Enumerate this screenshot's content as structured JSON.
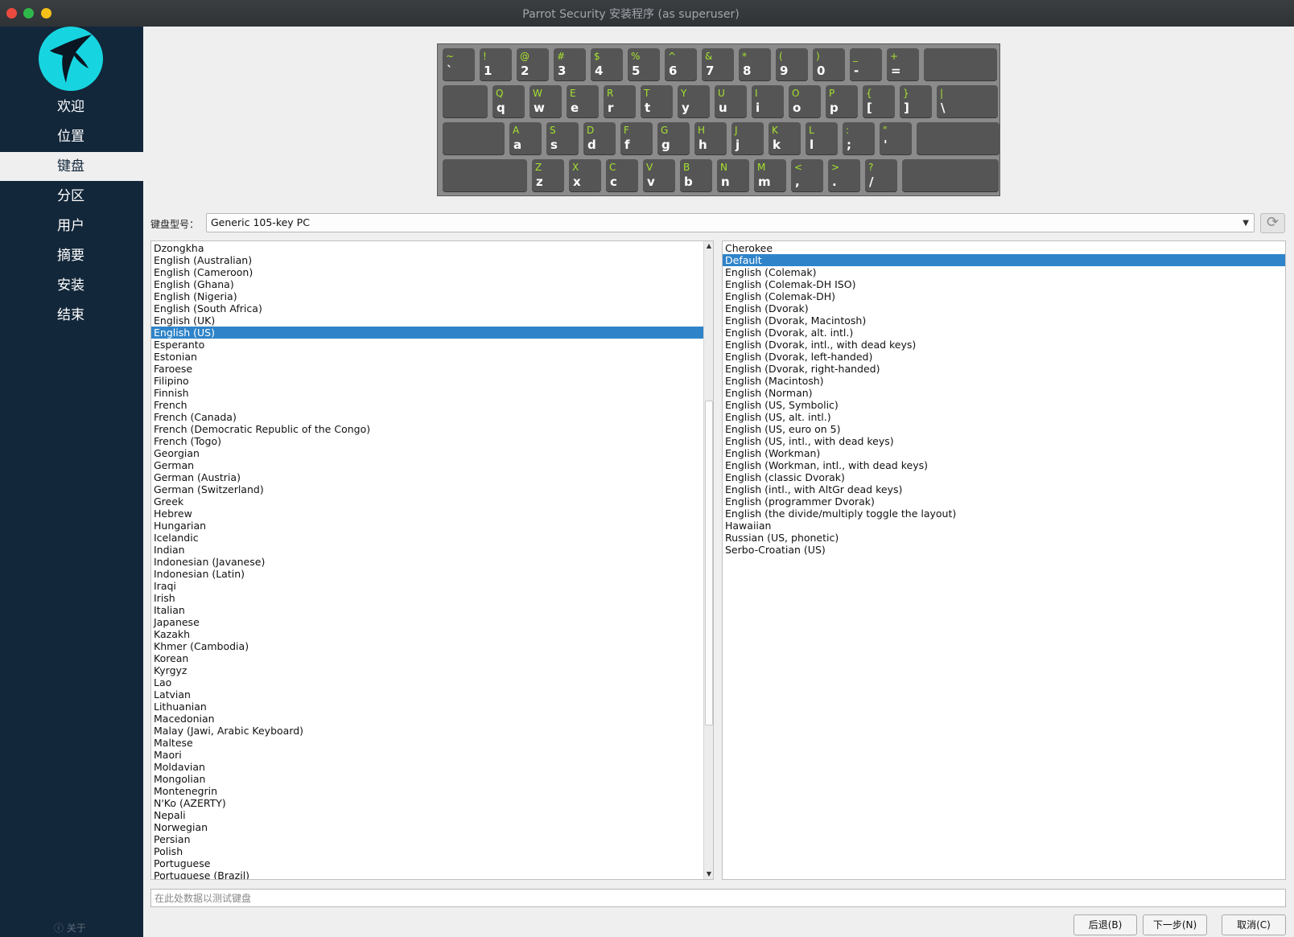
{
  "window": {
    "title": "Parrot Security 安装程序 (as superuser)"
  },
  "sidebar": {
    "logo_icon": "parrot-bird-logo",
    "items": [
      {
        "label": "欢迎"
      },
      {
        "label": "位置"
      },
      {
        "label": "键盘"
      },
      {
        "label": "分区"
      },
      {
        "label": "用户"
      },
      {
        "label": "摘要"
      },
      {
        "label": "安装"
      },
      {
        "label": "结束"
      }
    ],
    "active_index": 2,
    "about_label": "ⓘ 关于"
  },
  "keyboard_preview": {
    "rows": [
      [
        {
          "shift": "~",
          "main": "`"
        },
        {
          "shift": "!",
          "main": "1"
        },
        {
          "shift": "@",
          "main": "2"
        },
        {
          "shift": "#",
          "main": "3"
        },
        {
          "shift": "$",
          "main": "4"
        },
        {
          "shift": "%",
          "main": "5"
        },
        {
          "shift": "^",
          "main": "6"
        },
        {
          "shift": "&",
          "main": "7"
        },
        {
          "shift": "*",
          "main": "8"
        },
        {
          "shift": "(",
          "main": "9"
        },
        {
          "shift": ")",
          "main": "0"
        },
        {
          "shift": "_",
          "main": "-"
        },
        {
          "shift": "+",
          "main": "="
        },
        {
          "shift": "",
          "main": ""
        }
      ],
      [
        {
          "shift": "",
          "main": ""
        },
        {
          "shift": "Q",
          "main": "q"
        },
        {
          "shift": "W",
          "main": "w"
        },
        {
          "shift": "E",
          "main": "e"
        },
        {
          "shift": "R",
          "main": "r"
        },
        {
          "shift": "T",
          "main": "t"
        },
        {
          "shift": "Y",
          "main": "y"
        },
        {
          "shift": "U",
          "main": "u"
        },
        {
          "shift": "I",
          "main": "i"
        },
        {
          "shift": "O",
          "main": "o"
        },
        {
          "shift": "P",
          "main": "p"
        },
        {
          "shift": "{",
          "main": "["
        },
        {
          "shift": "}",
          "main": "]"
        },
        {
          "shift": "|",
          "main": "\\"
        }
      ],
      [
        {
          "shift": "",
          "main": ""
        },
        {
          "shift": "A",
          "main": "a"
        },
        {
          "shift": "S",
          "main": "s"
        },
        {
          "shift": "D",
          "main": "d"
        },
        {
          "shift": "F",
          "main": "f"
        },
        {
          "shift": "G",
          "main": "g"
        },
        {
          "shift": "H",
          "main": "h"
        },
        {
          "shift": "J",
          "main": "j"
        },
        {
          "shift": "K",
          "main": "k"
        },
        {
          "shift": "L",
          "main": "l"
        },
        {
          "shift": ":",
          "main": ";"
        },
        {
          "shift": "\"",
          "main": "'"
        },
        {
          "shift": "",
          "main": ""
        }
      ],
      [
        {
          "shift": "",
          "main": ""
        },
        {
          "shift": "Z",
          "main": "z"
        },
        {
          "shift": "X",
          "main": "x"
        },
        {
          "shift": "C",
          "main": "c"
        },
        {
          "shift": "V",
          "main": "v"
        },
        {
          "shift": "B",
          "main": "b"
        },
        {
          "shift": "N",
          "main": "n"
        },
        {
          "shift": "M",
          "main": "m"
        },
        {
          "shift": "<",
          "main": ","
        },
        {
          "shift": ">",
          "main": "."
        },
        {
          "shift": "?",
          "main": "/"
        },
        {
          "shift": "",
          "main": ""
        }
      ]
    ]
  },
  "model": {
    "label": "键盘型号：",
    "value": "Generic 105-key PC",
    "reset_icon": "reset-icon"
  },
  "layouts": {
    "selected_index": 7,
    "items": [
      "Dzongkha",
      "English (Australian)",
      "English (Cameroon)",
      "English (Ghana)",
      "English (Nigeria)",
      "English (South Africa)",
      "English (UK)",
      "English (US)",
      "Esperanto",
      "Estonian",
      "Faroese",
      "Filipino",
      "Finnish",
      "French",
      "French (Canada)",
      "French (Democratic Republic of the Congo)",
      "French (Togo)",
      "Georgian",
      "German",
      "German (Austria)",
      "German (Switzerland)",
      "Greek",
      "Hebrew",
      "Hungarian",
      "Icelandic",
      "Indian",
      "Indonesian (Javanese)",
      "Indonesian (Latin)",
      "Iraqi",
      "Irish",
      "Italian",
      "Japanese",
      "Kazakh",
      "Khmer (Cambodia)",
      "Korean",
      "Kyrgyz",
      "Lao",
      "Latvian",
      "Lithuanian",
      "Macedonian",
      "Malay (Jawi, Arabic Keyboard)",
      "Maltese",
      "Maori",
      "Moldavian",
      "Mongolian",
      "Montenegrin",
      "N'Ko (AZERTY)",
      "Nepali",
      "Norwegian",
      "Persian",
      "Polish",
      "Portuguese",
      "Portuguese (Brazil)"
    ]
  },
  "variants": {
    "selected_index": 1,
    "items": [
      "Cherokee",
      "Default",
      "English (Colemak)",
      "English (Colemak-DH ISO)",
      "English (Colemak-DH)",
      "English (Dvorak)",
      "English (Dvorak, Macintosh)",
      "English (Dvorak, alt. intl.)",
      "English (Dvorak, intl., with dead keys)",
      "English (Dvorak, left-handed)",
      "English (Dvorak, right-handed)",
      "English (Macintosh)",
      "English (Norman)",
      "English (US, Symbolic)",
      "English (US, alt. intl.)",
      "English (US, euro on 5)",
      "English (US, intl., with dead keys)",
      "English (Workman)",
      "English (Workman, intl., with dead keys)",
      "English (classic Dvorak)",
      "English (intl., with AltGr dead keys)",
      "English (programmer Dvorak)",
      "English (the divide/multiply toggle the layout)",
      "Hawaiian",
      "Russian (US, phonetic)",
      "Serbo-Croatian (US)"
    ]
  },
  "test_input": {
    "placeholder": "在此处数据以测试键盘",
    "value": ""
  },
  "buttons": {
    "back": "后退(B)",
    "next": "下一步(N)",
    "cancel": "取消(C)"
  },
  "colors": {
    "sidebar_bg": "#13273a",
    "accent_selection": "#2f84c9",
    "key_shift_text": "#a6e22e",
    "logo_bg": "#17d5e0"
  }
}
